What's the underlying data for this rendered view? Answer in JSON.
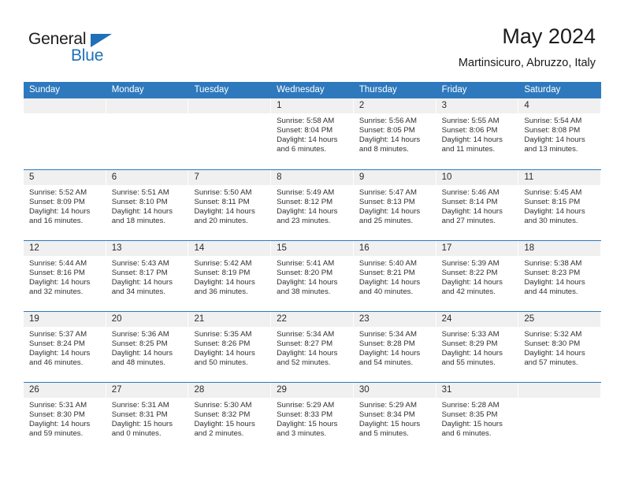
{
  "brand": {
    "name_top": "General",
    "name_bottom": "Blue",
    "accent_color": "#1f70b8"
  },
  "header": {
    "month_title": "May 2024",
    "location": "Martinsicuro, Abruzzo, Italy"
  },
  "calendar": {
    "header_color": "#2e79bd",
    "day_band_color": "#f0f0f0",
    "weekdays": [
      "Sunday",
      "Monday",
      "Tuesday",
      "Wednesday",
      "Thursday",
      "Friday",
      "Saturday"
    ],
    "weeks": [
      [
        {
          "empty": true
        },
        {
          "empty": true
        },
        {
          "empty": true
        },
        {
          "day": "1",
          "sunrise": "Sunrise: 5:58 AM",
          "sunset": "Sunset: 8:04 PM",
          "daylight_1": "Daylight: 14 hours",
          "daylight_2": "and 6 minutes."
        },
        {
          "day": "2",
          "sunrise": "Sunrise: 5:56 AM",
          "sunset": "Sunset: 8:05 PM",
          "daylight_1": "Daylight: 14 hours",
          "daylight_2": "and 8 minutes."
        },
        {
          "day": "3",
          "sunrise": "Sunrise: 5:55 AM",
          "sunset": "Sunset: 8:06 PM",
          "daylight_1": "Daylight: 14 hours",
          "daylight_2": "and 11 minutes."
        },
        {
          "day": "4",
          "sunrise": "Sunrise: 5:54 AM",
          "sunset": "Sunset: 8:08 PM",
          "daylight_1": "Daylight: 14 hours",
          "daylight_2": "and 13 minutes."
        }
      ],
      [
        {
          "day": "5",
          "sunrise": "Sunrise: 5:52 AM",
          "sunset": "Sunset: 8:09 PM",
          "daylight_1": "Daylight: 14 hours",
          "daylight_2": "and 16 minutes."
        },
        {
          "day": "6",
          "sunrise": "Sunrise: 5:51 AM",
          "sunset": "Sunset: 8:10 PM",
          "daylight_1": "Daylight: 14 hours",
          "daylight_2": "and 18 minutes."
        },
        {
          "day": "7",
          "sunrise": "Sunrise: 5:50 AM",
          "sunset": "Sunset: 8:11 PM",
          "daylight_1": "Daylight: 14 hours",
          "daylight_2": "and 20 minutes."
        },
        {
          "day": "8",
          "sunrise": "Sunrise: 5:49 AM",
          "sunset": "Sunset: 8:12 PM",
          "daylight_1": "Daylight: 14 hours",
          "daylight_2": "and 23 minutes."
        },
        {
          "day": "9",
          "sunrise": "Sunrise: 5:47 AM",
          "sunset": "Sunset: 8:13 PM",
          "daylight_1": "Daylight: 14 hours",
          "daylight_2": "and 25 minutes."
        },
        {
          "day": "10",
          "sunrise": "Sunrise: 5:46 AM",
          "sunset": "Sunset: 8:14 PM",
          "daylight_1": "Daylight: 14 hours",
          "daylight_2": "and 27 minutes."
        },
        {
          "day": "11",
          "sunrise": "Sunrise: 5:45 AM",
          "sunset": "Sunset: 8:15 PM",
          "daylight_1": "Daylight: 14 hours",
          "daylight_2": "and 30 minutes."
        }
      ],
      [
        {
          "day": "12",
          "sunrise": "Sunrise: 5:44 AM",
          "sunset": "Sunset: 8:16 PM",
          "daylight_1": "Daylight: 14 hours",
          "daylight_2": "and 32 minutes."
        },
        {
          "day": "13",
          "sunrise": "Sunrise: 5:43 AM",
          "sunset": "Sunset: 8:17 PM",
          "daylight_1": "Daylight: 14 hours",
          "daylight_2": "and 34 minutes."
        },
        {
          "day": "14",
          "sunrise": "Sunrise: 5:42 AM",
          "sunset": "Sunset: 8:19 PM",
          "daylight_1": "Daylight: 14 hours",
          "daylight_2": "and 36 minutes."
        },
        {
          "day": "15",
          "sunrise": "Sunrise: 5:41 AM",
          "sunset": "Sunset: 8:20 PM",
          "daylight_1": "Daylight: 14 hours",
          "daylight_2": "and 38 minutes."
        },
        {
          "day": "16",
          "sunrise": "Sunrise: 5:40 AM",
          "sunset": "Sunset: 8:21 PM",
          "daylight_1": "Daylight: 14 hours",
          "daylight_2": "and 40 minutes."
        },
        {
          "day": "17",
          "sunrise": "Sunrise: 5:39 AM",
          "sunset": "Sunset: 8:22 PM",
          "daylight_1": "Daylight: 14 hours",
          "daylight_2": "and 42 minutes."
        },
        {
          "day": "18",
          "sunrise": "Sunrise: 5:38 AM",
          "sunset": "Sunset: 8:23 PM",
          "daylight_1": "Daylight: 14 hours",
          "daylight_2": "and 44 minutes."
        }
      ],
      [
        {
          "day": "19",
          "sunrise": "Sunrise: 5:37 AM",
          "sunset": "Sunset: 8:24 PM",
          "daylight_1": "Daylight: 14 hours",
          "daylight_2": "and 46 minutes."
        },
        {
          "day": "20",
          "sunrise": "Sunrise: 5:36 AM",
          "sunset": "Sunset: 8:25 PM",
          "daylight_1": "Daylight: 14 hours",
          "daylight_2": "and 48 minutes."
        },
        {
          "day": "21",
          "sunrise": "Sunrise: 5:35 AM",
          "sunset": "Sunset: 8:26 PM",
          "daylight_1": "Daylight: 14 hours",
          "daylight_2": "and 50 minutes."
        },
        {
          "day": "22",
          "sunrise": "Sunrise: 5:34 AM",
          "sunset": "Sunset: 8:27 PM",
          "daylight_1": "Daylight: 14 hours",
          "daylight_2": "and 52 minutes."
        },
        {
          "day": "23",
          "sunrise": "Sunrise: 5:34 AM",
          "sunset": "Sunset: 8:28 PM",
          "daylight_1": "Daylight: 14 hours",
          "daylight_2": "and 54 minutes."
        },
        {
          "day": "24",
          "sunrise": "Sunrise: 5:33 AM",
          "sunset": "Sunset: 8:29 PM",
          "daylight_1": "Daylight: 14 hours",
          "daylight_2": "and 55 minutes."
        },
        {
          "day": "25",
          "sunrise": "Sunrise: 5:32 AM",
          "sunset": "Sunset: 8:30 PM",
          "daylight_1": "Daylight: 14 hours",
          "daylight_2": "and 57 minutes."
        }
      ],
      [
        {
          "day": "26",
          "sunrise": "Sunrise: 5:31 AM",
          "sunset": "Sunset: 8:30 PM",
          "daylight_1": "Daylight: 14 hours",
          "daylight_2": "and 59 minutes."
        },
        {
          "day": "27",
          "sunrise": "Sunrise: 5:31 AM",
          "sunset": "Sunset: 8:31 PM",
          "daylight_1": "Daylight: 15 hours",
          "daylight_2": "and 0 minutes."
        },
        {
          "day": "28",
          "sunrise": "Sunrise: 5:30 AM",
          "sunset": "Sunset: 8:32 PM",
          "daylight_1": "Daylight: 15 hours",
          "daylight_2": "and 2 minutes."
        },
        {
          "day": "29",
          "sunrise": "Sunrise: 5:29 AM",
          "sunset": "Sunset: 8:33 PM",
          "daylight_1": "Daylight: 15 hours",
          "daylight_2": "and 3 minutes."
        },
        {
          "day": "30",
          "sunrise": "Sunrise: 5:29 AM",
          "sunset": "Sunset: 8:34 PM",
          "daylight_1": "Daylight: 15 hours",
          "daylight_2": "and 5 minutes."
        },
        {
          "day": "31",
          "sunrise": "Sunrise: 5:28 AM",
          "sunset": "Sunset: 8:35 PM",
          "daylight_1": "Daylight: 15 hours",
          "daylight_2": "and 6 minutes."
        },
        {
          "empty": true
        }
      ]
    ]
  }
}
